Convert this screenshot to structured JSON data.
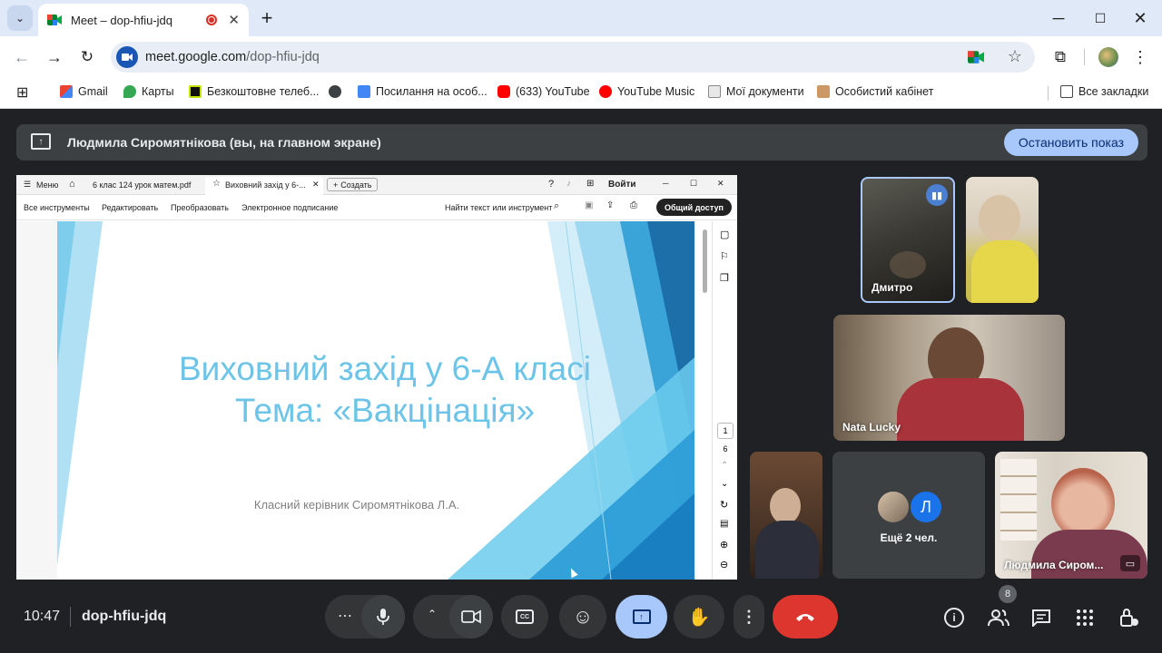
{
  "browser": {
    "tab_title": "Meet – dop-hfiu-jdq",
    "new_tab": "+",
    "url_host": "meet.google.com",
    "url_path": "/dop-hfiu-jdq",
    "bookmarks": [
      "Gmail",
      "Карты",
      "Безкоштовне телеб...",
      "Посилання на особ...",
      "(633) YouTube",
      "YouTube Music",
      "Мої документи",
      "Особистий кабінет"
    ],
    "all_bookmarks": "Все закладки"
  },
  "banner": {
    "text": "Людмила Сиромятнікова (вы, на главном экране)",
    "stop_button": "Остановить показ"
  },
  "pdf": {
    "menu": "Меню",
    "tab1": "6 клас 124 урок матем.pdf",
    "tab2": "Виховний захід у 6-...",
    "create": "Создать",
    "sign_in": "Войти",
    "tools": [
      "Все инструменты",
      "Редактировать",
      "Преобразовать",
      "Электронное подписание"
    ],
    "find": "Найти текст или инструмент",
    "share": "Общий доступ",
    "page_current": "1",
    "page_total": "6"
  },
  "slide": {
    "line1": "Виховний захід у 6-А класі",
    "line2": "Тема: «Вакцінація»",
    "teacher": "Класний керівник Сиромятнікова Л.А."
  },
  "participants": {
    "p1": "Дмитро",
    "p3": "Nata Lucky",
    "more_initial": "Л",
    "more_text": "Ещё 2 чел.",
    "self": "Людмила Сиром..."
  },
  "controls": {
    "time": "10:47",
    "meeting_code": "dop-hfiu-jdq",
    "people_count": "8"
  },
  "colors": {
    "accent": "#a8c7fa",
    "hangup": "#dc362e",
    "slide_text": "#6cc4e8"
  }
}
